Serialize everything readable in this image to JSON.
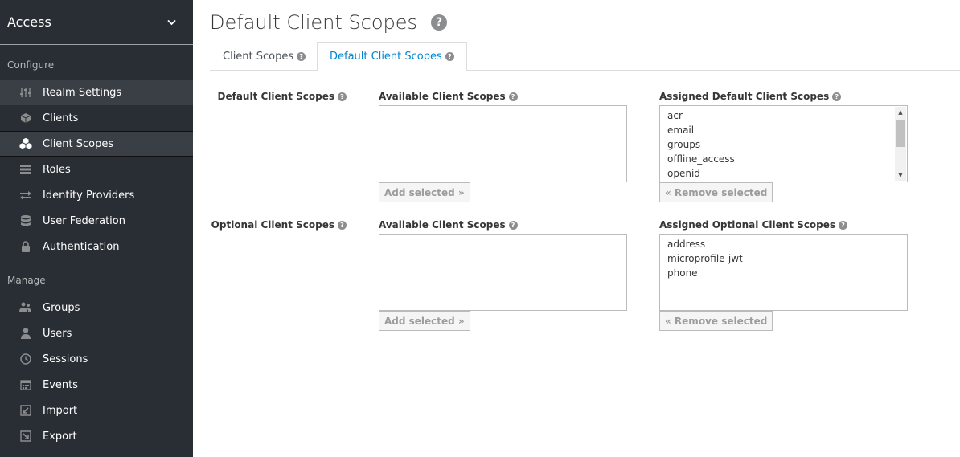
{
  "sidebar": {
    "realm": "Access",
    "configure_label": "Configure",
    "manage_label": "Manage",
    "configure_items": [
      {
        "label": "Realm Settings",
        "icon": "sliders-icon"
      },
      {
        "label": "Clients",
        "icon": "cube-icon"
      },
      {
        "label": "Client Scopes",
        "icon": "cubes-icon"
      },
      {
        "label": "Roles",
        "icon": "list-icon"
      },
      {
        "label": "Identity Providers",
        "icon": "exchange-icon"
      },
      {
        "label": "User Federation",
        "icon": "database-icon"
      },
      {
        "label": "Authentication",
        "icon": "lock-icon"
      }
    ],
    "manage_items": [
      {
        "label": "Groups",
        "icon": "users-icon"
      },
      {
        "label": "Users",
        "icon": "user-icon"
      },
      {
        "label": "Sessions",
        "icon": "clock-icon"
      },
      {
        "label": "Events",
        "icon": "calendar-icon"
      },
      {
        "label": "Import",
        "icon": "import-icon"
      },
      {
        "label": "Export",
        "icon": "export-icon"
      }
    ]
  },
  "main": {
    "title": "Default Client Scopes",
    "tabs": [
      {
        "label": "Client Scopes"
      },
      {
        "label": "Default Client Scopes"
      }
    ],
    "default_section": {
      "row_label": "Default Client Scopes",
      "available_label": "Available Client Scopes",
      "assigned_label": "Assigned Default Client Scopes",
      "available_items": [],
      "assigned_items": [
        "acr",
        "email",
        "groups",
        "offline_access",
        "openid"
      ],
      "add_button": "Add selected »",
      "remove_button": "« Remove selected"
    },
    "optional_section": {
      "row_label": "Optional Client Scopes",
      "available_label": "Available Client Scopes",
      "assigned_label": "Assigned Optional Client Scopes",
      "available_items": [],
      "assigned_items": [
        "address",
        "microprofile-jwt",
        "phone"
      ],
      "add_button": "Add selected »",
      "remove_button": "« Remove selected"
    }
  }
}
